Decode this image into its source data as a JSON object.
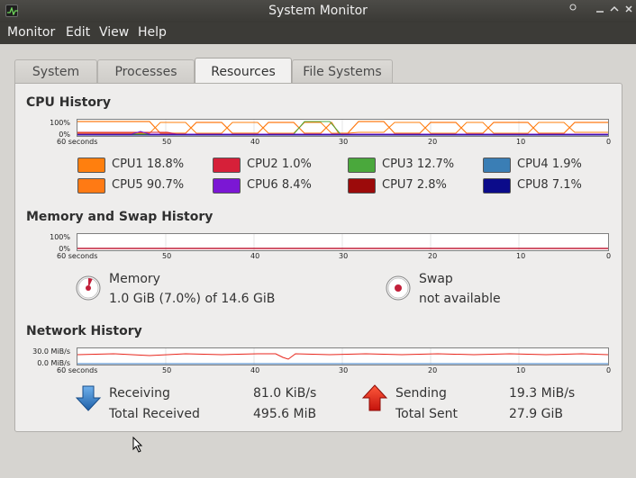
{
  "window": {
    "title": "System Monitor"
  },
  "menu": [
    "Monitor",
    "Edit",
    "View",
    "Help"
  ],
  "tabs": [
    {
      "label": "System"
    },
    {
      "label": "Processes"
    },
    {
      "label": "Resources",
      "active": true
    },
    {
      "label": "File Systems"
    }
  ],
  "cpu": {
    "title": "CPU History",
    "y_top": "100%",
    "y_bottom": "0%",
    "x_labels": [
      "60 seconds",
      "50",
      "40",
      "30",
      "20",
      "10",
      "0"
    ],
    "legend": [
      {
        "label": "CPU1",
        "value": "18.8%",
        "color": "#ff7f0e"
      },
      {
        "label": "CPU2",
        "value": "1.0%",
        "color": "#d62039"
      },
      {
        "label": "CPU3",
        "value": "12.7%",
        "color": "#4aa83c"
      },
      {
        "label": "CPU4",
        "value": "1.9%",
        "color": "#3a7eb5"
      },
      {
        "label": "CPU5",
        "value": "90.7%",
        "color": "#ff7a14"
      },
      {
        "label": "CPU6",
        "value": "8.4%",
        "color": "#7b17d4"
      },
      {
        "label": "CPU7",
        "value": "2.8%",
        "color": "#9c0a0a"
      },
      {
        "label": "CPU8",
        "value": "7.1%",
        "color": "#0b0b8a"
      }
    ]
  },
  "memory": {
    "title": "Memory and Swap History",
    "y_top": "100%",
    "y_bottom": "0%",
    "x_labels": [
      "60 seconds",
      "50",
      "40",
      "30",
      "20",
      "10",
      "0"
    ],
    "memory_label": "Memory",
    "memory_value": "1.0 GiB (7.0%) of 14.6 GiB",
    "memory_fraction": 0.07,
    "memory_color": "#c2203a",
    "swap_label": "Swap",
    "swap_value": "not available",
    "swap_color": "#c2203a"
  },
  "network": {
    "title": "Network History",
    "y_top": "30.0 MiB/s",
    "y_bottom": "0.0 MiB/s",
    "x_labels": [
      "60 seconds",
      "50",
      "40",
      "30",
      "20",
      "10",
      "0"
    ],
    "receiving_label": "Receiving",
    "receiving_value": "81.0 KiB/s",
    "total_received_label": "Total Received",
    "total_received_value": "495.6 MiB",
    "sending_label": "Sending",
    "sending_value": "19.3 MiB/s",
    "total_sent_label": "Total Sent",
    "total_sent_value": "27.9 GiB",
    "receiving_color": "#3a7ec7",
    "sending_color": "#e8261c"
  }
}
